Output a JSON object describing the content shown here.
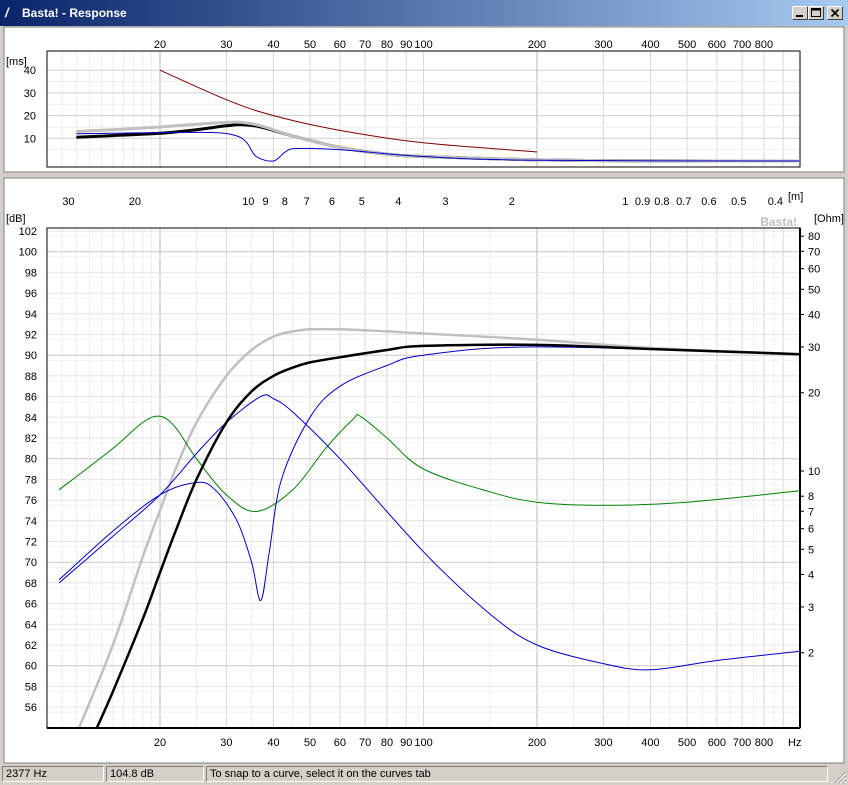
{
  "window": {
    "title": "Basta! - Response"
  },
  "title_buttons": [
    "minimize-button",
    "maximize-button",
    "close-button"
  ],
  "top_plot": {
    "unit_label": "[ms]",
    "freq_ticks": [
      "20",
      "30",
      "40",
      "50",
      "60",
      "70",
      "80",
      "90",
      "100",
      "200",
      "300",
      "400",
      "500",
      "600",
      "700",
      "800"
    ],
    "y_ticks": [
      "40",
      "30",
      "20",
      "10"
    ]
  },
  "main_plot": {
    "left_unit": "[dB]",
    "right_unit": "[Ohm]",
    "wavelength_unit": "[m]",
    "x_unit": "Hz",
    "watermark": "Basta!",
    "freq_ticks": [
      "20",
      "30",
      "40",
      "50",
      "60",
      "70",
      "80",
      "90",
      "100",
      "200",
      "300",
      "400",
      "500",
      "600",
      "700",
      "800"
    ],
    "wavelength_ticks": [
      "30",
      "20",
      "10",
      "9",
      "8",
      "7",
      "6",
      "5",
      "4",
      "3",
      "2",
      "1",
      "0.9",
      "0.8",
      "0.7",
      "0.6",
      "0.5",
      "0.4"
    ],
    "db_ticks": [
      "102",
      "100",
      "98",
      "96",
      "94",
      "92",
      "90",
      "88",
      "86",
      "84",
      "82",
      "80",
      "78",
      "76",
      "74",
      "72",
      "70",
      "68",
      "66",
      "64",
      "62",
      "60",
      "58",
      "56"
    ],
    "ohm_ticks": [
      "80",
      "70",
      "60",
      "50",
      "40",
      "30",
      "20",
      "10",
      "8",
      "7",
      "6",
      "5",
      "4",
      "3",
      "2"
    ]
  },
  "colors": {
    "total_response": "#000000",
    "reference": "#c0c0c0",
    "driver_curves": "#0000c8",
    "impedance": "#008000",
    "excursion": "#800000",
    "grid_major": "#c0c0c0",
    "grid_minor": "#e8e8e8"
  },
  "chart_data": [
    {
      "type": "line",
      "title": "",
      "xlabel": "Hz",
      "ylabel": "[ms]",
      "xscale": "log",
      "ylim": [
        0,
        45
      ],
      "grid": true,
      "series": [
        {
          "color": "#000000",
          "x": [
            12,
            15,
            20,
            25,
            30,
            33,
            37,
            45,
            60,
            80,
            100,
            200,
            400,
            1000
          ],
          "values": [
            10.5,
            11.2,
            12.2,
            13.8,
            15.5,
            16,
            15,
            11,
            6,
            3,
            2,
            0.5,
            0.1,
            0
          ]
        },
        {
          "color": "#c0c0c0",
          "x": [
            12,
            15,
            20,
            25,
            30,
            33,
            37,
            45,
            60,
            80,
            100,
            200,
            400,
            1000
          ],
          "values": [
            13,
            13.8,
            15,
            16.2,
            17,
            17,
            15.5,
            11,
            6,
            3,
            2,
            0.5,
            0.1,
            0
          ]
        },
        {
          "color": "#0000c8",
          "x": [
            12,
            20,
            28,
            32,
            34,
            36,
            40,
            43,
            46,
            60,
            100,
            200,
            1000
          ],
          "values": [
            12,
            12.5,
            12.5,
            11,
            8,
            2,
            0,
            4,
            5.5,
            5,
            2,
            0.3,
            0
          ]
        },
        {
          "color": "#800000",
          "x": [
            20,
            30,
            40,
            60,
            100,
            200
          ],
          "values": [
            40,
            27,
            20,
            13.5,
            8,
            4
          ]
        }
      ]
    },
    {
      "type": "line",
      "title": "",
      "xlabel": "Hz",
      "ylabel": "[dB]",
      "y2label": "[Ohm]",
      "xscale": "log",
      "ylim": [
        54,
        104
      ],
      "grid": true,
      "series": [
        {
          "color": "#c0c0c0",
          "x": [
            12.2,
            15,
            18,
            20,
            22,
            25,
            30,
            35,
            40,
            45,
            50,
            60,
            80,
            100,
            200,
            400,
            1000
          ],
          "values": [
            54,
            62,
            70.5,
            75,
            79,
            83.5,
            88,
            90.5,
            91.8,
            92.3,
            92.5,
            92.5,
            92.3,
            92.1,
            91.5,
            90.7,
            90.1
          ]
        },
        {
          "color": "#000000",
          "x": [
            13.6,
            15,
            18,
            20,
            22,
            25,
            30,
            35,
            40,
            45,
            50,
            60,
            80,
            100,
            200,
            400,
            1000
          ],
          "values": [
            54,
            57.5,
            64.5,
            69,
            73,
            78,
            83.5,
            86.5,
            88,
            88.8,
            89.3,
            89.8,
            90.5,
            90.9,
            91,
            90.6,
            90.1
          ]
        },
        {
          "color": "#0000c8",
          "x": [
            10.8,
            15,
            20,
            25,
            30,
            37,
            40,
            45,
            60,
            100,
            150,
            200,
            300,
            400,
            600,
            1000
          ],
          "values": [
            68,
            72.5,
            76.5,
            80.5,
            83.5,
            86,
            85.8,
            84.5,
            80,
            71,
            65,
            62,
            60.2,
            59.6,
            60.5,
            61.4
          ]
        },
        {
          "color": "#0000c8",
          "x": [
            10.8,
            15,
            20,
            25,
            28,
            32,
            35,
            37,
            39,
            42,
            50,
            60,
            80,
            100,
            200,
            1000
          ],
          "values": [
            68.3,
            73,
            76.5,
            77.7,
            77,
            74,
            70,
            66.3,
            71,
            78,
            84,
            87,
            89,
            90,
            90.8,
            90.1
          ]
        },
        {
          "color": "#008000",
          "x": [
            10.8,
            15,
            18,
            20,
            22,
            25,
            30,
            36,
            45,
            55,
            65,
            68,
            80,
            100,
            150,
            200,
            300,
            500,
            1000
          ],
          "values": [
            77,
            81,
            83.5,
            84.1,
            83,
            80,
            76.5,
            74.9,
            77,
            81,
            83.8,
            84.1,
            82,
            79,
            76.8,
            75.8,
            75.5,
            75.8,
            76.9
          ]
        }
      ]
    }
  ],
  "status": {
    "frequency": "2377 Hz",
    "level": "104.8 dB",
    "message": "To snap to a curve, select it on the curves tab"
  }
}
